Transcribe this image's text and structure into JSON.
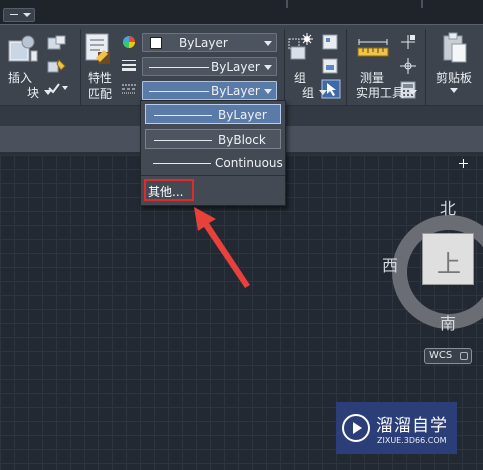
{
  "ribbon": {
    "insert_label": "插入",
    "properties_label_line1": "特性",
    "properties_label_line2": "匹配",
    "group_label": "组",
    "measure_label": "测量",
    "clipboard_label": "剪贴板",
    "panels": {
      "block": "块",
      "group": "组",
      "utilities": "实用工具"
    },
    "color_combo": "ByLayer",
    "linetype_combo": "ByLayer",
    "lineweight_combo": "ByLayer"
  },
  "dropdown": {
    "items": [
      {
        "label": "ByLayer"
      },
      {
        "label": "ByBlock"
      },
      {
        "label": "Continuous"
      }
    ],
    "other_label": "其他..."
  },
  "viewcube": {
    "north": "北",
    "south": "南",
    "west": "西",
    "face": "上",
    "wcs": "WCS"
  },
  "watermark": {
    "title": "溜溜自学",
    "url": "ZIXUE.3D66.COM"
  },
  "colors": {
    "highlight_box": "#e12b2b",
    "arrow": "#e8403a",
    "selected_item": "#5a7aa8"
  }
}
